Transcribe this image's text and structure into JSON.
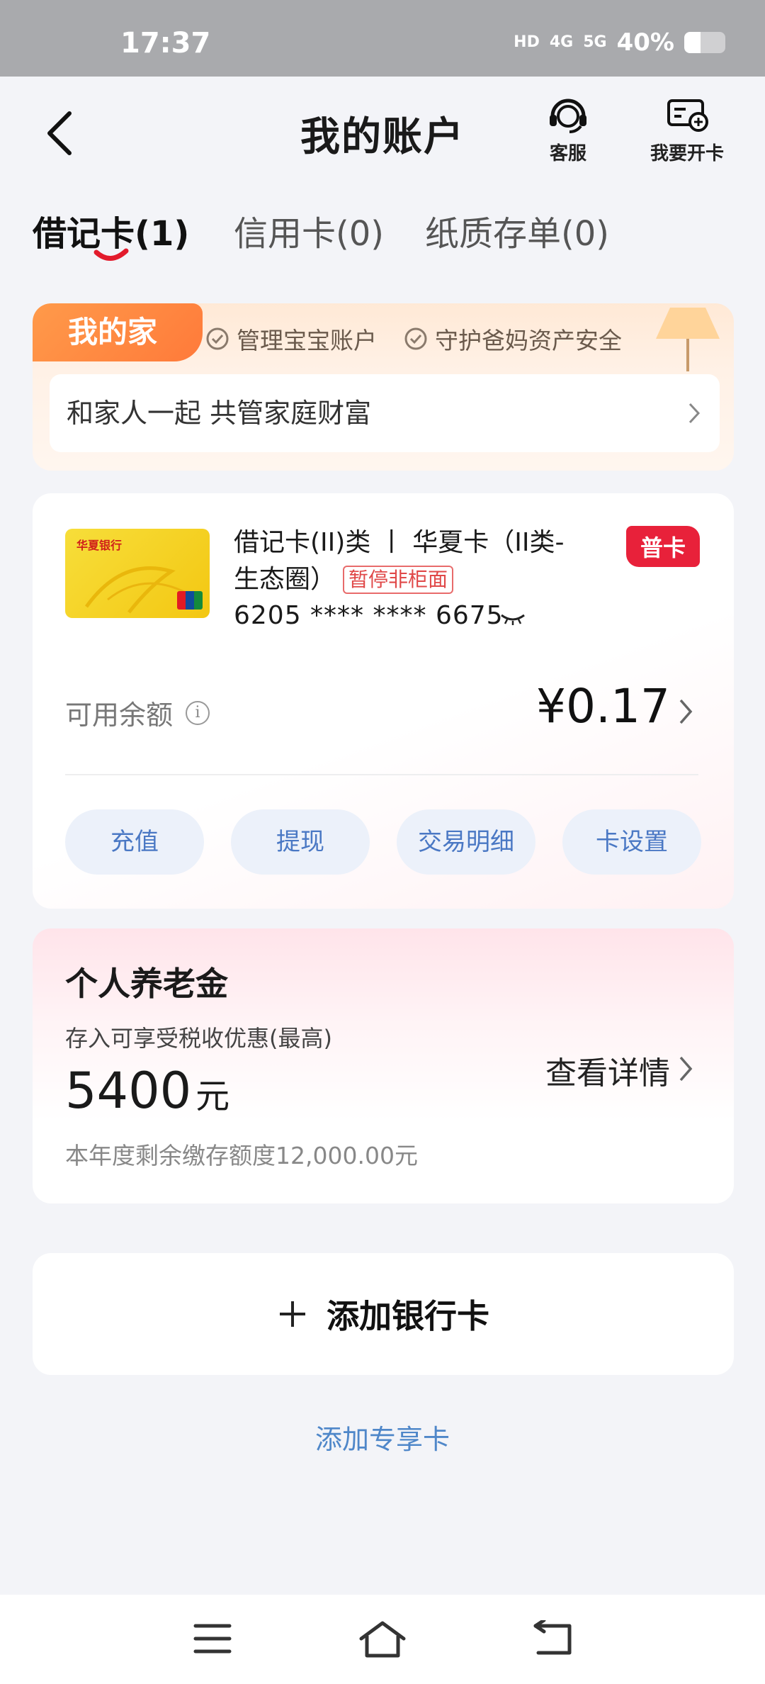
{
  "status_bar": {
    "time": "17:37",
    "hd": "HD",
    "signal1": "4G",
    "signal2": "5G",
    "battery": "40%"
  },
  "header": {
    "title": "我的账户",
    "service_label": "客服",
    "open_card_label": "我要开卡"
  },
  "tabs": [
    {
      "label": "借记卡(1)"
    },
    {
      "label": "信用卡(0)"
    },
    {
      "label": "纸质存单(0)"
    }
  ],
  "family": {
    "tag": "我的家",
    "features": [
      "管理宝宝账户",
      "守护爸妈资产安全"
    ],
    "row_text": "和家人一起 共管家庭财富"
  },
  "debit_card": {
    "name_line": "借记卡(II)类 丨 华夏卡（II类-生态圈）",
    "paused_badge": "暂停非柜面",
    "card_number": "6205 **** **** 6675",
    "type_badge": "普卡",
    "bank_name": "华夏银行",
    "balance_label": "可用余额",
    "balance": "¥0.17",
    "actions": [
      "充值",
      "提现",
      "交易明细",
      "卡设置"
    ]
  },
  "pension": {
    "title": "个人养老金",
    "subtitle": "存入可享受税收优惠(最高)",
    "amount": "5400",
    "unit": "元",
    "note": "本年度剩余缴存额度12,000.00元",
    "detail_link": "查看详情"
  },
  "add_card_label": "添加银行卡",
  "special_card_label": "添加专享卡",
  "colors": {
    "brand_red": "#e8213a",
    "link_blue": "#4f87c9",
    "family_orange": "#ff8a42"
  }
}
